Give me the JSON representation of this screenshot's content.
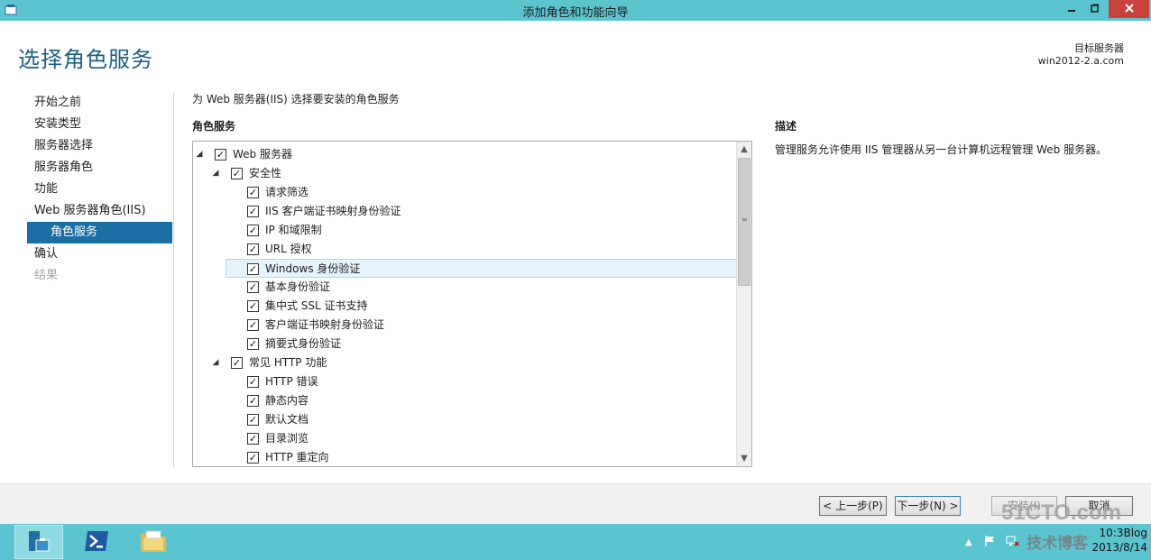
{
  "window": {
    "title": "添加角色和功能向导"
  },
  "header": {
    "page_title": "选择角色服务",
    "target_label": "目标服务器",
    "target_server": "win2012-2.a.com"
  },
  "nav": {
    "items": [
      {
        "label": "开始之前",
        "state": "normal"
      },
      {
        "label": "安装类型",
        "state": "normal"
      },
      {
        "label": "服务器选择",
        "state": "normal"
      },
      {
        "label": "服务器角色",
        "state": "normal"
      },
      {
        "label": "功能",
        "state": "normal"
      },
      {
        "label": "Web 服务器角色(IIS)",
        "state": "normal"
      },
      {
        "label": "角色服务",
        "state": "active"
      },
      {
        "label": "确认",
        "state": "normal"
      },
      {
        "label": "结果",
        "state": "disabled"
      }
    ]
  },
  "content": {
    "intro": "为 Web 服务器(IIS) 选择要安装的角色服务",
    "section_label": "角色服务",
    "description_label": "描述",
    "description_text": "管理服务允许使用 IIS 管理器从另一台计算机远程管理 Web 服务器。",
    "tree": [
      {
        "label": "Web 服务器",
        "level": 0,
        "expanded": true,
        "checked": true
      },
      {
        "label": "安全性",
        "level": 1,
        "expanded": true,
        "checked": true
      },
      {
        "label": "请求筛选",
        "level": 2,
        "checked": true
      },
      {
        "label": "IIS 客户端证书映射身份验证",
        "level": 2,
        "checked": true
      },
      {
        "label": "IP 和域限制",
        "level": 2,
        "checked": true
      },
      {
        "label": "URL 授权",
        "level": 2,
        "checked": true
      },
      {
        "label": "Windows 身份验证",
        "level": 2,
        "checked": true,
        "selected": true
      },
      {
        "label": "基本身份验证",
        "level": 2,
        "checked": true
      },
      {
        "label": "集中式 SSL 证书支持",
        "level": 2,
        "checked": true
      },
      {
        "label": "客户端证书映射身份验证",
        "level": 2,
        "checked": true
      },
      {
        "label": "摘要式身份验证",
        "level": 2,
        "checked": true
      },
      {
        "label": "常见 HTTP 功能",
        "level": 1,
        "expanded": true,
        "checked": true
      },
      {
        "label": "HTTP 错误",
        "level": 2,
        "checked": true
      },
      {
        "label": "静态内容",
        "level": 2,
        "checked": true
      },
      {
        "label": "默认文档",
        "level": 2,
        "checked": true
      },
      {
        "label": "目录浏览",
        "level": 2,
        "checked": true
      },
      {
        "label": "HTTP 重定向",
        "level": 2,
        "checked": true
      }
    ]
  },
  "footer": {
    "prev_label": "< 上一步(P)",
    "next_label": "下一步(N) >",
    "install_label": "安装(I)",
    "cancel_label": "取消"
  },
  "taskbar": {
    "time": "10:3",
    "date": "2013/8/14"
  },
  "watermark": {
    "line1": "51CTO.com",
    "line2": "技术博客",
    "blog": "Blog"
  },
  "colors": {
    "titlebar": "#5bc5cf",
    "accent": "#1c6ea6",
    "page_title": "#1b5f84",
    "close_button": "#c7423a"
  }
}
